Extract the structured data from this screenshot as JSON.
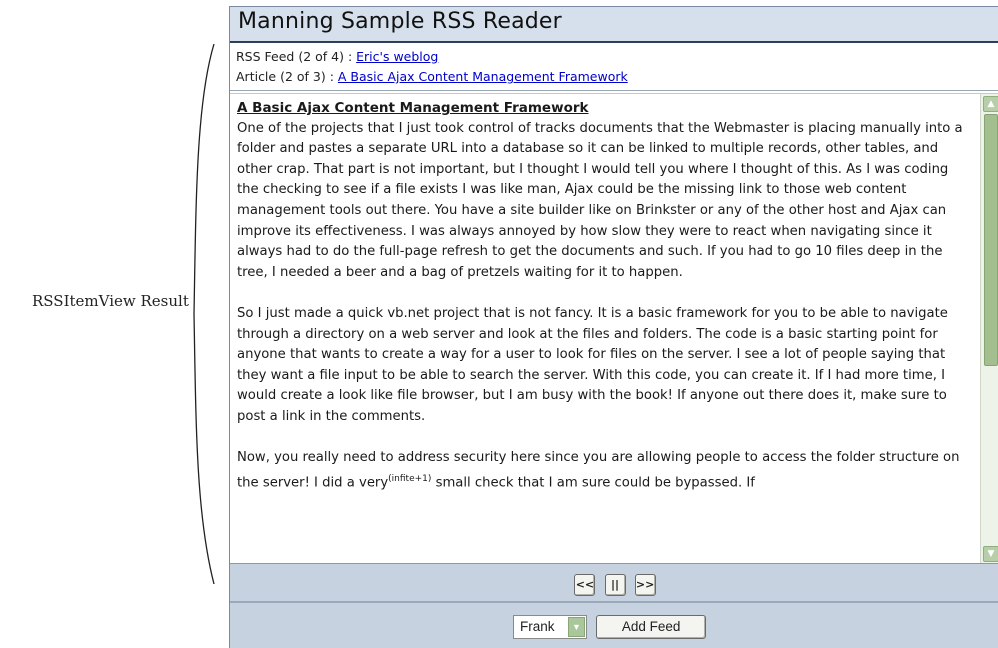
{
  "annotation": "RSSItemView Result",
  "app": {
    "title": "Manning Sample RSS Reader"
  },
  "info": {
    "feed_prefix": "RSS Feed (2 of 4) : ",
    "feed_link": "Eric's weblog",
    "article_prefix": "Article (2 of 3) : ",
    "article_link": "A Basic Ajax Content Management Framework"
  },
  "article": {
    "heading": "A Basic Ajax Content Management Framework",
    "p1": "One of the projects that I just took control of tracks documents that the Webmaster is placing manually into a folder and pastes a separate URL into a database so it can be linked to multiple records, other tables, and other crap. That part is not important, but I thought I would tell you where I thought of this. As I was coding the checking to see if a file exists I was like man, Ajax could be the missing link to those web content management tools out there. You have a site builder like on Brinkster or any of the other host and Ajax can improve its effectiveness. I was always annoyed by how slow they were to react when navigating since it always had to do the full-page refresh to get the documents and such. If you had to go 10 files deep in the tree, I needed a beer and a bag of pretzels waiting for it to happen.",
    "p2": "So I just made a quick vb.net project that is not fancy. It is a basic framework for you to be able to navigate through a directory on a web server and look at the files and folders. The code is a basic starting point for anyone that wants to create a way for a user to look for files on the server. I see a lot of people saying that they want a file input to be able to search the server. With this code, you can create it. If I had more time, I would create a look like file browser, but I am busy with the book! If anyone out there does it, make sure to post a link in the comments.",
    "p3_start": "Now, you really need to address security here since you are allowing people to access the folder structure on the server! I did a very",
    "p3_sup": "(infite+1)",
    "p3_end": " small check that I am sure could be bypassed. If"
  },
  "nav": {
    "prev": "<<",
    "pause": "||",
    "next": ">>"
  },
  "feed": {
    "selected": "Frank",
    "add_label": "Add Feed"
  },
  "colors": {
    "header_bg": "#d6e0ec",
    "toolbar_bg": "#c6d2e0",
    "scroll_green": "#a3bf90",
    "link": "#0000cc"
  }
}
